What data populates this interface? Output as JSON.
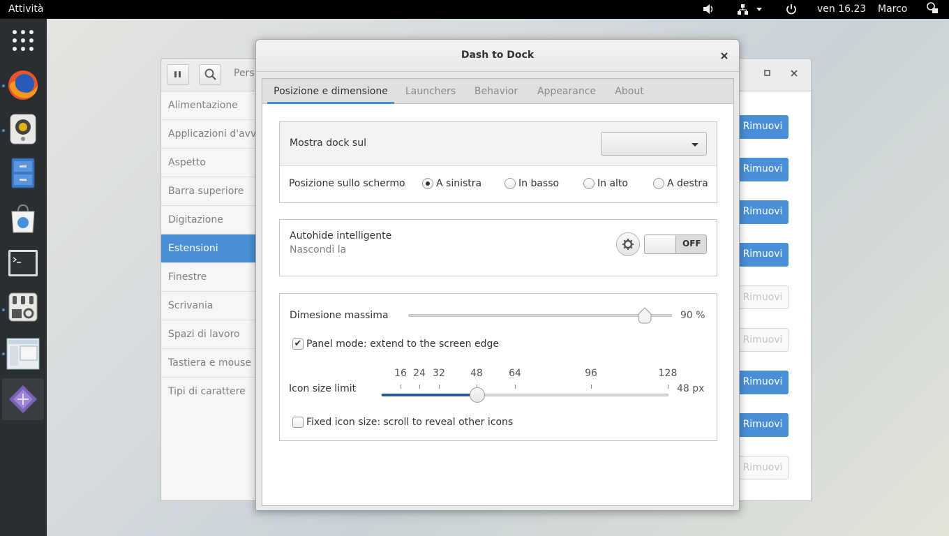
{
  "topbar": {
    "activities": "Attività",
    "clock": "ven 16.23",
    "user": "Marco",
    "icons": [
      "volume-icon",
      "network-icon",
      "power-icon",
      "accessibility-icon"
    ]
  },
  "dock": {
    "apps": [
      "app-grid-icon",
      "firefox-icon",
      "rhythmbox-icon",
      "files-icon",
      "software-icon",
      "terminal-icon",
      "tweaks-icon",
      "window-thumbnail-icon",
      "dash-to-dock-settings-icon"
    ]
  },
  "settings_window": {
    "search_text": "Pers",
    "sidebar": [
      "Alimentazione",
      "Applicazioni d'avvio",
      "Aspetto",
      "Barra superiore",
      "Digitazione",
      "Estensioni",
      "Finestre",
      "Scrivania",
      "Spazi di lavoro",
      "Tastiera e mouse",
      "Tipi di carattere"
    ],
    "active_item": "Estensioni",
    "remove_label": "Rimuovi"
  },
  "dialog": {
    "title": "Dash to Dock",
    "tabs": [
      "Posizione e dimensione",
      "Launchers",
      "Behavior",
      "Appearance",
      "About"
    ],
    "active_tab": "Posizione e dimensione",
    "show_dock_label": "Mostra dock sul",
    "show_dock_value": "",
    "position_label": "Posizione sullo schermo",
    "position_options": [
      "A sinistra",
      "In basso",
      "In alto",
      "A destra"
    ],
    "position_selected": "A sinistra",
    "autohide_label": "Autohide intelligente",
    "autohide_sublabel": "Nascondi la",
    "autohide_switch": "OFF",
    "max_size_label": "Dimesione massima",
    "max_size_value": "90 %",
    "max_size_fraction": 0.9,
    "panel_mode_label": "Panel mode: extend to the screen edge",
    "panel_mode_checked": true,
    "icon_size_label": "Icon size limit",
    "icon_size_marks": [
      "16",
      "24",
      "32",
      "48",
      "64",
      "96",
      "128"
    ],
    "icon_size_value": "48 px",
    "fixed_icon_label": "Fixed icon size: scroll to reveal other icons",
    "fixed_icon_checked": false
  },
  "colors": {
    "accent": "#4a90d9",
    "topbar": "#000000",
    "dock": "#2b2e31"
  }
}
